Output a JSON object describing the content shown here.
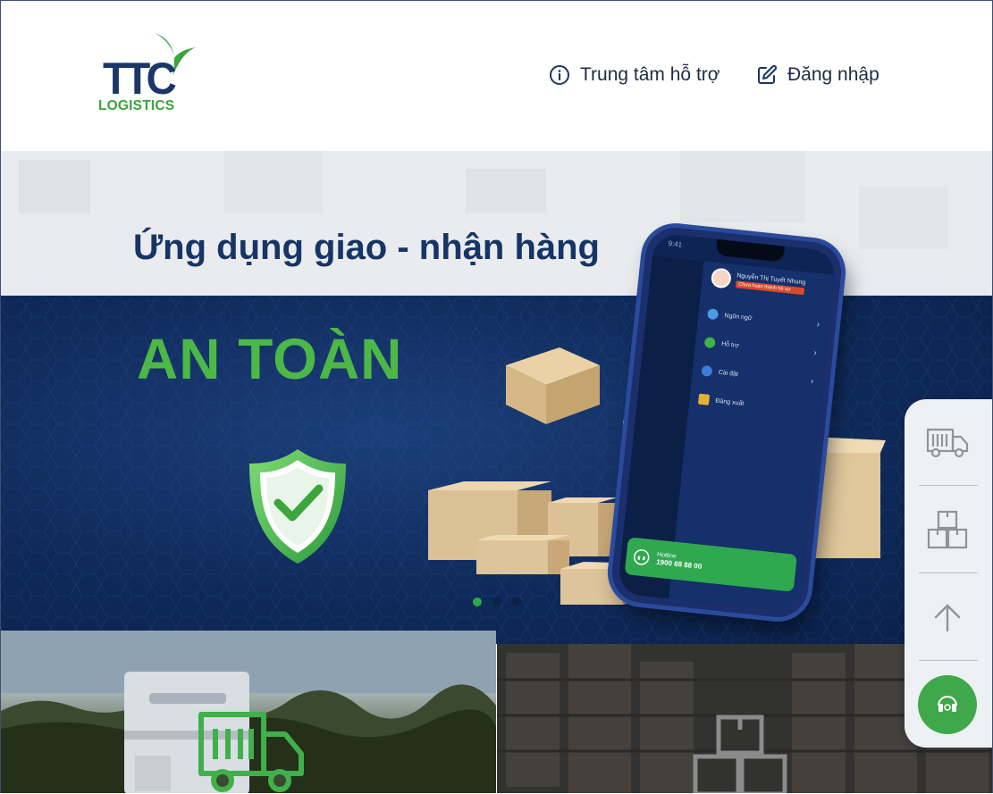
{
  "header": {
    "logo": {
      "brand": "TTC",
      "subtitle": "LOGISTICS"
    },
    "nav": {
      "support_label": "Trung tâm hỗ trợ",
      "login_label": "Đăng nhập"
    }
  },
  "banner": {
    "title": "Ứng dụng giao - nhận hàng",
    "headline": "AN TOÀN",
    "active_slide": 1,
    "slide_count": 3,
    "phone": {
      "user_name": "Nguyễn Thị Tuyết Nhung",
      "user_badge": "Chưa hoàn thành hồ sơ",
      "menu": [
        "Ngôn ngữ",
        "Hỗ trợ",
        "Cài đặt",
        "Đăng xuất"
      ],
      "hotline_label": "Hotline",
      "hotline_number": "1900 88 88 00",
      "time": "9:41"
    }
  },
  "colors": {
    "brand_navy": "#1b3668",
    "brand_green": "#3aa63c",
    "banner_dark": "#0f2a5a",
    "toolbar_green": "#3fa84a"
  },
  "toolbar": {
    "items": [
      "truck-icon",
      "boxes-icon",
      "arrow-up-icon",
      "headset-icon"
    ]
  },
  "cards": {
    "left_icon": "truck-icon",
    "right_icon": "boxes-icon"
  }
}
